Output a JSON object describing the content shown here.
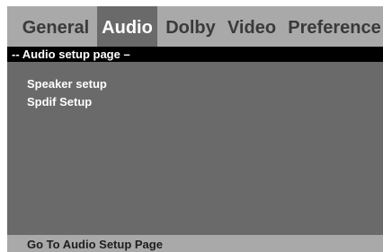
{
  "tabs": [
    {
      "label": "General",
      "active": false
    },
    {
      "label": "Audio",
      "active": true
    },
    {
      "label": "Dolby",
      "active": false
    },
    {
      "label": "Video",
      "active": false
    },
    {
      "label": "Preference",
      "active": false
    }
  ],
  "page_header": "-- Audio setup page –",
  "menu": {
    "items": [
      "Speaker setup",
      "Spdif Setup"
    ]
  },
  "status_bar": {
    "text": "Go To Audio Setup Page"
  },
  "colors": {
    "panel": "#6a6a6a",
    "tab_bar": "#a9a9a9",
    "header_bar": "#000000",
    "active_tab_text": "#ffffff",
    "inactive_tab_text": "#3a3a3a"
  }
}
